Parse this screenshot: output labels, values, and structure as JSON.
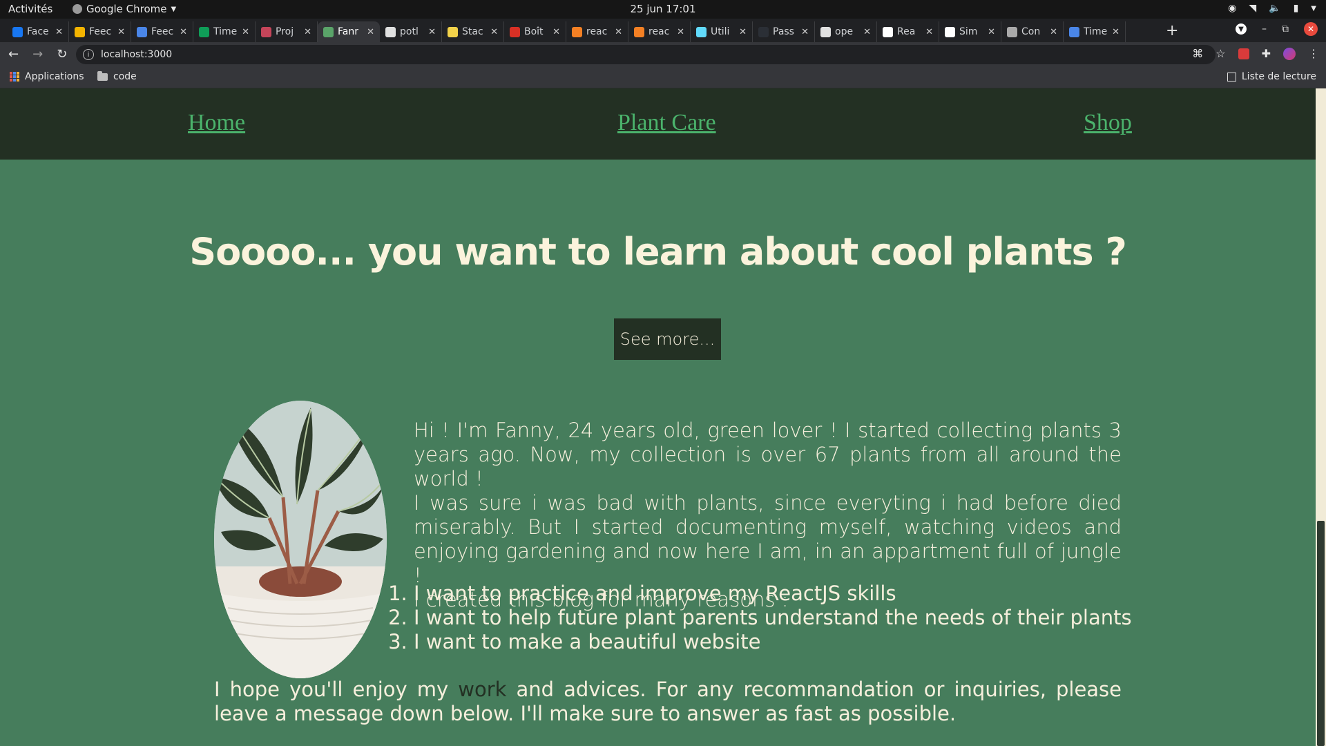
{
  "system": {
    "activities": "Activités",
    "app_name": "Google Chrome",
    "clock": "25 jun  17:01"
  },
  "tabs": [
    {
      "title": "Face",
      "color": "#1877f2"
    },
    {
      "title": "Feec",
      "color": "#f4b400"
    },
    {
      "title": "Feec",
      "color": "#4a86e8"
    },
    {
      "title": "Time",
      "color": "#0f9d58"
    },
    {
      "title": "Proj",
      "color": "#c5455a"
    },
    {
      "title": "Fanr",
      "color": "#5aa469",
      "active": true
    },
    {
      "title": "potl",
      "color": "#e0e0e0"
    },
    {
      "title": "Stac",
      "color": "#f2d24a"
    },
    {
      "title": "Boît",
      "color": "#d93025"
    },
    {
      "title": "reac",
      "color": "#f48024"
    },
    {
      "title": "reac",
      "color": "#f48024"
    },
    {
      "title": "Utili",
      "color": "#61dafb"
    },
    {
      "title": "Pass",
      "color": "#2b2f36"
    },
    {
      "title": "ope",
      "color": "#e0e0e0"
    },
    {
      "title": "Rea",
      "color": "#ffffff"
    },
    {
      "title": "Sim",
      "color": "#ffffff"
    },
    {
      "title": "Con",
      "color": "#aaaaaa"
    },
    {
      "title": "Time",
      "color": "#4a86e8"
    }
  ],
  "address_bar": {
    "url": "localhost:3000"
  },
  "bookmarks": {
    "apps": "Applications",
    "folder": "code",
    "reading_list": "Liste de lecture"
  },
  "site": {
    "nav": {
      "home": "Home",
      "plant_care": "Plant Care",
      "shop": "Shop"
    },
    "hero_title": "Soooo... you want to learn about cool plants ?",
    "cta": "See more...",
    "intro": [
      "Hi ! I'm Fanny, 24 years old, green lover ! I started collecting plants 3 years ago. Now, my collection is over 67 plants from all around the world !",
      "I was sure i was bad with plants, since everyting i had before died miserably. But I started documenting myself, watching videos and enjoying gardening and now here I am, in an appartment full of jungle !",
      "I created this blog for many reasons :"
    ],
    "reasons": [
      "I want to practice and improve my ReactJS skills",
      "I want to help future plant parents understand the needs of their plants",
      "I want to make a beautiful website"
    ],
    "closing_before": "I hope you'll enjoy my ",
    "closing_link": "work",
    "closing_after": " and advices. For any recommandation or inquiries, please leave a message down below. I'll make sure to answer as fast as possible."
  },
  "colors": {
    "page_bg": "#467d5c",
    "nav_bg": "#233023",
    "nav_link": "#4bb36c",
    "cream_text": "#f6efdc"
  }
}
